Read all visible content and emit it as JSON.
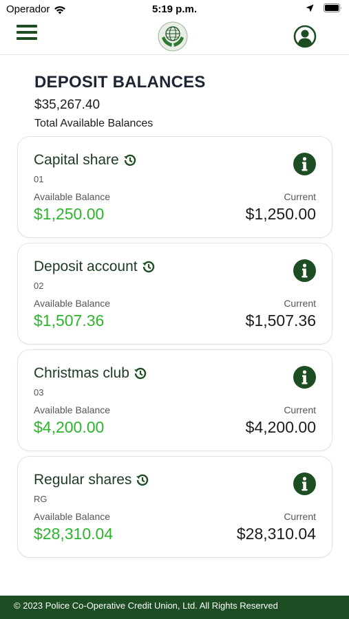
{
  "status_bar": {
    "carrier": "Operador",
    "time": "5:19 p.m."
  },
  "nav": {
    "menu_icon": "hamburger-menu-icon",
    "logo_icon": "credit-union-globe-hands-logo",
    "profile_icon": "user-profile-icon"
  },
  "header": {
    "title": "DEPOSIT BALANCES",
    "total_amount": "$35,267.40",
    "total_label": "Total Available Balances"
  },
  "accounts": [
    {
      "name": "Capital share",
      "number": "01",
      "available_label": "Available Balance",
      "available": "$1,250.00",
      "current_label": "Current",
      "current": "$1,250.00"
    },
    {
      "name": "Deposit account",
      "number": "02",
      "available_label": "Available Balance",
      "available": "$1,507.36",
      "current_label": "Current",
      "current": "$1,507.36"
    },
    {
      "name": "Christmas club",
      "number": "03",
      "available_label": "Available Balance",
      "available": "$4,200.00",
      "current_label": "Current",
      "current": "$4,200.00"
    },
    {
      "name": "Regular shares",
      "number": "RG",
      "available_label": "Available Balance",
      "available": "$28,310.04",
      "current_label": "Current",
      "current": "$28,310.04"
    }
  ],
  "footer": {
    "text": "© 2023 Police Co-Operative Credit Union, Ltd. All Rights Reserved"
  },
  "colors": {
    "brand_green": "#1d4d22",
    "available_green": "#2cb52c",
    "title_navy": "#1b2533"
  }
}
